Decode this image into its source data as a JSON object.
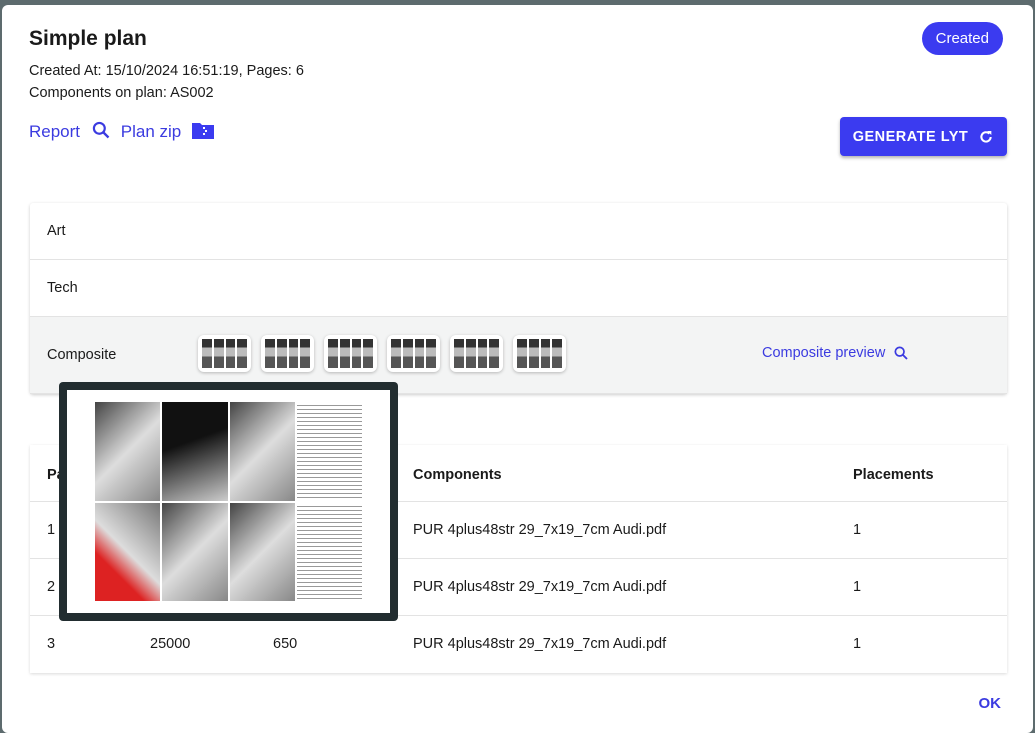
{
  "header": {
    "title": "Simple plan",
    "created": "Created At: 15/10/2024 16:51:19, Pages: 6",
    "components": "Components on plan:  AS002",
    "status": "Created"
  },
  "links": {
    "report": "Report",
    "plan_zip": "Plan zip"
  },
  "generate_label": "GENERATE LYT",
  "sections": {
    "art": "Art",
    "tech": "Tech",
    "composite": "Composite",
    "composite_preview": "Composite preview"
  },
  "table": {
    "headers": [
      "Pa",
      "Components",
      "Placements"
    ],
    "rows": [
      {
        "page": "1",
        "c2": "",
        "c3": "",
        "component": "PUR 4plus48str 29_7x19_7cm Audi.pdf",
        "placements": "1"
      },
      {
        "page": "2",
        "c2": "",
        "c3": "",
        "component": "PUR 4plus48str 29_7x19_7cm Audi.pdf",
        "placements": "1"
      },
      {
        "page": "3",
        "c2": "25000",
        "c3": "650",
        "component": "PUR 4plus48str 29_7x19_7cm Audi.pdf",
        "placements": "1"
      }
    ]
  },
  "ok_label": "OK",
  "colors": {
    "accent": "#3b3bf0"
  }
}
